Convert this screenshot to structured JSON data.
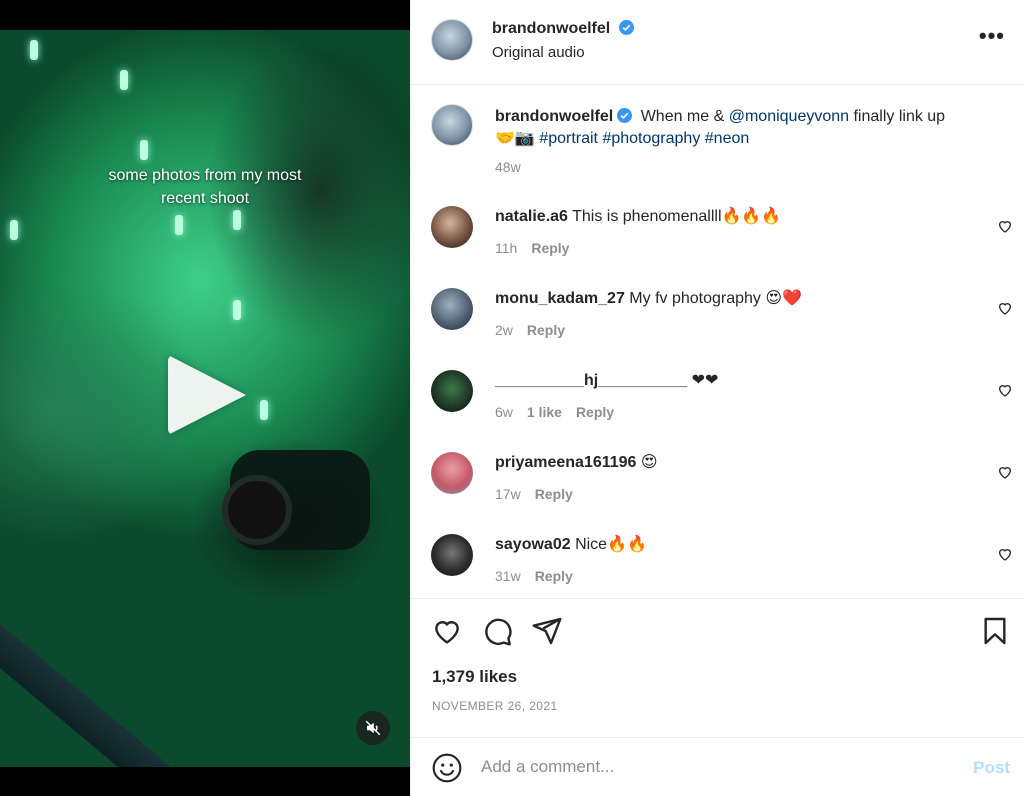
{
  "media": {
    "caption_line1": "some photos from my most",
    "caption_line2": "recent shoot"
  },
  "header": {
    "username": "brandonwoelfel",
    "audio": "Original audio",
    "more_label": "•••"
  },
  "caption": {
    "username": "brandonwoelfel",
    "text_pre": "When me & ",
    "mention": "@moniqueyvonn",
    "text_post": " finally link up",
    "emojis": "🤝📷",
    "hashtags": [
      "#portrait",
      "#photography",
      "#neon"
    ],
    "time": "48w"
  },
  "comments": [
    {
      "username": "natalie.a6",
      "text": "This is phenomenallll🔥🔥🔥",
      "time": "11h",
      "likes": "",
      "reply": "Reply",
      "avatar_color": "#6b4a3a"
    },
    {
      "username": "monu_kadam_27",
      "text": "My fv photography 😍❤️",
      "time": "2w",
      "likes": "",
      "reply": "Reply",
      "avatar_color": "#4a5a6a"
    },
    {
      "username": "__________hj__________",
      "text": "❤❤",
      "time": "6w",
      "likes": "1 like",
      "reply": "Reply",
      "avatar_color": "#1f3a26"
    },
    {
      "username": "priyameena161196",
      "text": "😍",
      "time": "17w",
      "likes": "",
      "reply": "Reply",
      "avatar_color": "#c55a68"
    },
    {
      "username": "sayowa02",
      "text": "Nice🔥🔥",
      "time": "31w",
      "likes": "",
      "reply": "Reply",
      "avatar_color": "#2d2d2d"
    }
  ],
  "footer": {
    "likes": "1,379 likes",
    "date": "NOVEMBER 26, 2021",
    "comment_placeholder": "Add a comment...",
    "post_label": "Post"
  },
  "colors": {
    "verified": "#3897f0",
    "link": "#00376b",
    "post_disabled": "#b2dffc"
  }
}
